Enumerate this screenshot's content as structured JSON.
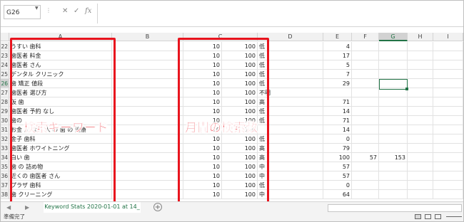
{
  "formula_bar": {
    "name_box": "G26",
    "cancel_icon": "✕",
    "enter_icon": "✓",
    "function_icon": "fx"
  },
  "columns": [
    "A",
    "B",
    "C",
    "D",
    "E",
    "F",
    "G",
    "H",
    "I"
  ],
  "selected_column": "G",
  "rows": [
    {
      "num": "22",
      "a": "うすい 歯科",
      "b": "10",
      "c": "100",
      "d": "低",
      "e": "4",
      "f": "",
      "g": ""
    },
    {
      "num": "23",
      "a": "歯医者 料金",
      "b": "10",
      "c": "100",
      "d": "低",
      "e": "17",
      "f": "",
      "g": ""
    },
    {
      "num": "24",
      "a": "歯医者 さん",
      "b": "10",
      "c": "100",
      "d": "低",
      "e": "5",
      "f": "",
      "g": ""
    },
    {
      "num": "25",
      "a": "デンタル クリニック",
      "b": "10",
      "c": "100",
      "d": "低",
      "e": "7",
      "f": "",
      "g": ""
    },
    {
      "num": "26",
      "a": "歯 矯正 値段",
      "b": "10",
      "c": "100",
      "d": "低",
      "e": "29",
      "f": "",
      "g": ""
    },
    {
      "num": "27",
      "a": "歯医者 選び方",
      "b": "10",
      "c": "100",
      "d": "不明",
      "e": "",
      "f": "",
      "g": ""
    },
    {
      "num": "28",
      "a": "仮 歯",
      "b": "10",
      "c": "100",
      "d": "高",
      "e": "71",
      "f": "",
      "g": ""
    },
    {
      "num": "29",
      "a": "歯医者 予約 なし",
      "b": "10",
      "c": "100",
      "d": "低",
      "e": "14",
      "f": "",
      "g": ""
    },
    {
      "num": "30",
      "a": "歯の",
      "b": "10",
      "c": "100",
      "d": "低",
      "e": "71",
      "f": "",
      "g": ""
    },
    {
      "num": "31",
      "a": "お金 が ない 人 の 歯 の 治療",
      "b": "10",
      "c": "100",
      "d": "",
      "e": "14",
      "f": "",
      "g": ""
    },
    {
      "num": "32",
      "a": "金子 歯科",
      "b": "10",
      "c": "100",
      "d": "低",
      "e": "0",
      "f": "",
      "g": ""
    },
    {
      "num": "33",
      "a": "歯医者 ホワイトニング",
      "b": "10",
      "c": "100",
      "d": "高",
      "e": "79",
      "f": "",
      "g": ""
    },
    {
      "num": "34",
      "a": "白い 歯",
      "b": "10",
      "c": "100",
      "d": "高",
      "e": "100",
      "f": "57",
      "g": "153"
    },
    {
      "num": "35",
      "a": "歯 の 詰め物",
      "b": "10",
      "c": "100",
      "d": "中",
      "e": "57",
      "f": "",
      "g": ""
    },
    {
      "num": "36",
      "a": "近くの 歯医者 さん",
      "b": "10",
      "c": "100",
      "d": "中",
      "e": "57",
      "f": "",
      "g": ""
    },
    {
      "num": "37",
      "a": "プラザ 歯科",
      "b": "10",
      "c": "100",
      "d": "低",
      "e": "0",
      "f": "",
      "g": ""
    },
    {
      "num": "38",
      "a": "歯 クリーニング",
      "b": "10",
      "c": "100",
      "d": "中",
      "e": "64",
      "f": "",
      "g": ""
    }
  ],
  "annotations": {
    "left_label": "検索キーワード",
    "right_label": "月間の検索数"
  },
  "sheet_tab": "Keyword Stats 2020-01-01 at 14_",
  "status_text": "準備完了",
  "accent_color": "#217346",
  "annotation_color": "#e8141e"
}
